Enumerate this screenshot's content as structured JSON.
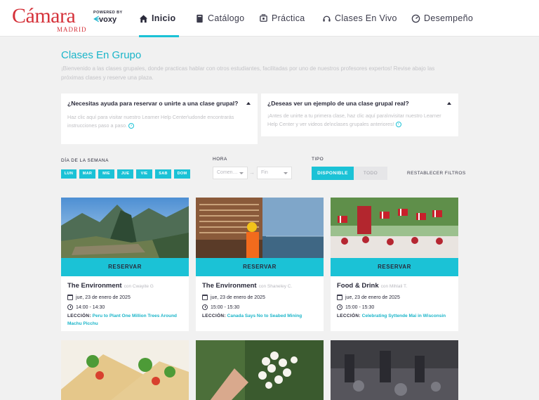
{
  "brand": {
    "logo_text": "Cámara",
    "logo_sub": "MADRID",
    "powered_label": "POWERED BY",
    "powered_brand": "voxy"
  },
  "nav": {
    "items": [
      {
        "label": "Inicio",
        "icon": "home-icon",
        "active": true
      },
      {
        "label": "Catálogo",
        "icon": "book-icon",
        "active": false
      },
      {
        "label": "Práctica",
        "icon": "practice-icon",
        "active": false
      },
      {
        "label": "Clases En Vivo",
        "icon": "headset-icon",
        "active": false
      },
      {
        "label": "Desempeño",
        "icon": "gauge-icon",
        "active": false
      }
    ]
  },
  "page": {
    "title": "Clases En Grupo",
    "intro": "¡Bienvenido a las clases grupales, donde practicas hablar con otros estudiantes, facilitadas por uno de nuestros profesores expertos! Revise abajo las próximas clases y reserve una plaza."
  },
  "info_boxes": [
    {
      "title": "¿Necesitas ayuda para reservar o unirte a una clase grupal?",
      "body": "Haz clic aquí para visitar nuestro Learner Help Center\\udonde encontrarás instrucciones paso a paso."
    },
    {
      "title": "¿Deseas ver un ejemplo de una clase grupal real?",
      "body": "¡Antes de unirte a tu primera clase, haz clic aquí para\\nvisitar nuestro Learner Help Center y ver videos de\\nclases grupales anteriores!"
    }
  ],
  "filters": {
    "day_label": "DÍA DE LA SEMANA",
    "days": [
      "LUN",
      "MAR",
      "MIE",
      "JUE",
      "VIE",
      "SAB",
      "DOM"
    ],
    "hour_label": "HORA",
    "hour_start_placeholder": "Comen…",
    "hour_end_placeholder": "Fin",
    "type_label": "TIPO",
    "type_on": "DISPONIBLE",
    "type_off": "TODO",
    "reset": "RESTABLECER FILTROS"
  },
  "colors": {
    "accent": "#1bc2d6",
    "brand_red": "#d5323a"
  },
  "cards": [
    {
      "image": "machu-picchu-photo",
      "reserve": "RESERVAR",
      "title": "The Environment",
      "teacher": "con Cwayite G",
      "date": "jue, 23 de enero de 2025",
      "time": "14:00 - 14:30",
      "lesson_key": "LECCIÓN:",
      "lesson": "Peru to Plant One Million Trees Around Machu Picchu"
    },
    {
      "image": "seabed-mining-worker-photo",
      "reserve": "RESERVAR",
      "title": "The Environment",
      "teacher": "con Shaneley C.",
      "date": "jue, 23 de enero de 2025",
      "time": "15:00 - 15:30",
      "lesson_key": "LECCIÓN:",
      "lesson": "Canada Says No to Seabed Mining"
    },
    {
      "image": "norway-parade-photo",
      "reserve": "RESERVAR",
      "title": "Food & Drink",
      "teacher": "con Mihlali T.",
      "date": "jue, 23 de enero de 2025",
      "time": "15:00 - 15:30",
      "lesson_key": "LECCIÓN:",
      "lesson": "Celebrating Syttende Mai in Wisconsin"
    }
  ],
  "preview_cards": [
    {
      "image": "wrap-food-photo"
    },
    {
      "image": "white-flowers-photo"
    },
    {
      "image": "street-market-photo"
    }
  ]
}
